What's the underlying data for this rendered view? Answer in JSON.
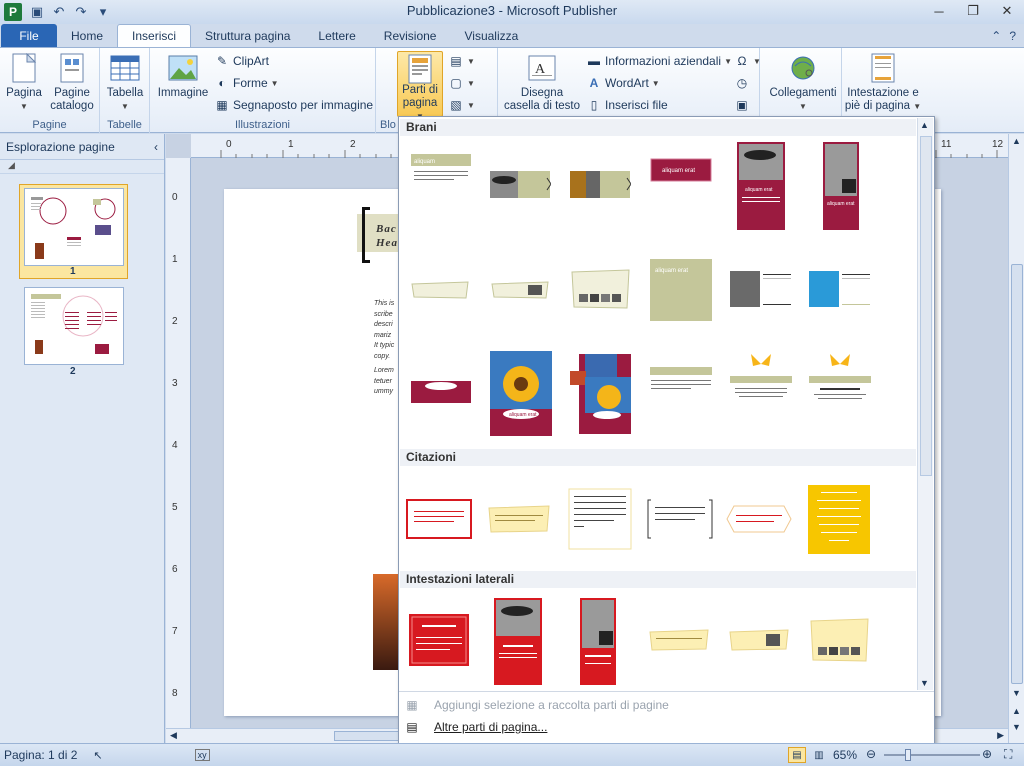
{
  "window": {
    "title": "Pubblicazione3 - Microsoft Publisher",
    "app_icon": "P",
    "controls": [
      "minimize-icon",
      "restore-icon",
      "close-icon"
    ]
  },
  "tabs": {
    "file": "File",
    "items": [
      "Home",
      "Inserisci",
      "Struttura pagina",
      "Lettere",
      "Revisione",
      "Visualizza"
    ],
    "active": "Inserisci"
  },
  "ribbon": {
    "pagine": {
      "label": "Pagine",
      "pagina": "Pagina",
      "catalogo_1": "Pagine",
      "catalogo_2": "catalogo"
    },
    "tabelle": {
      "label": "Tabelle",
      "tabella": "Tabella"
    },
    "illustrazioni": {
      "label": "Illustrazioni",
      "immagine": "Immagine",
      "clipart": "ClipArt",
      "forme": "Forme",
      "segnaposto": "Segnaposto per immagine"
    },
    "blocchi": {
      "label_partial": "Blo",
      "parti_1": "Parti di",
      "parti_2": "pagina"
    },
    "testo": {
      "disegna_1": "Disegna",
      "disegna_2": "casella di testo",
      "info": "Informazioni aziendali",
      "wordart": "WordArt",
      "inserisci_file": "Inserisci file"
    },
    "collegamenti": {
      "label": "Collegamenti"
    },
    "intestazione": {
      "line1": "Intestazione e",
      "line2": "piè di pagina"
    }
  },
  "nav": {
    "title": "Esplorazione pagine",
    "pages": [
      "1",
      "2"
    ]
  },
  "document": {
    "heading_1": "Bac",
    "heading_2": "Hea",
    "body_lines": [
      "This is",
      "scribe",
      "descri",
      "mariz",
      "It typic",
      "copy."
    ],
    "lorem_lines": [
      "Lorem",
      "tetuer",
      "ummy"
    ]
  },
  "ruler": {
    "h": [
      "0",
      "1",
      "2",
      "11",
      "12"
    ],
    "v": [
      "0",
      "1",
      "2",
      "3",
      "4",
      "5",
      "6",
      "7",
      "8"
    ]
  },
  "gallery": {
    "sections": [
      "Brani",
      "Citazioni",
      "Intestazioni laterali"
    ],
    "brani_texts": [
      "aliquam",
      "aliquam erat",
      "aliquam erat",
      "aliquam erat",
      "aliquam erat",
      "aliquam erat"
    ],
    "footer_add": "Aggiungi selezione a raccolta parti di pagine",
    "footer_more": "Altre parti di pagina..."
  },
  "colors": {
    "maroon": "#9b1b40",
    "olive": "#c4c69a",
    "red": "#d71920",
    "cream": "#fcefb4",
    "yellow": "#f7c600",
    "accent": "#2a66b5"
  },
  "status": {
    "page_info": "Pagina: 1 di 2",
    "zoom": "65%"
  }
}
